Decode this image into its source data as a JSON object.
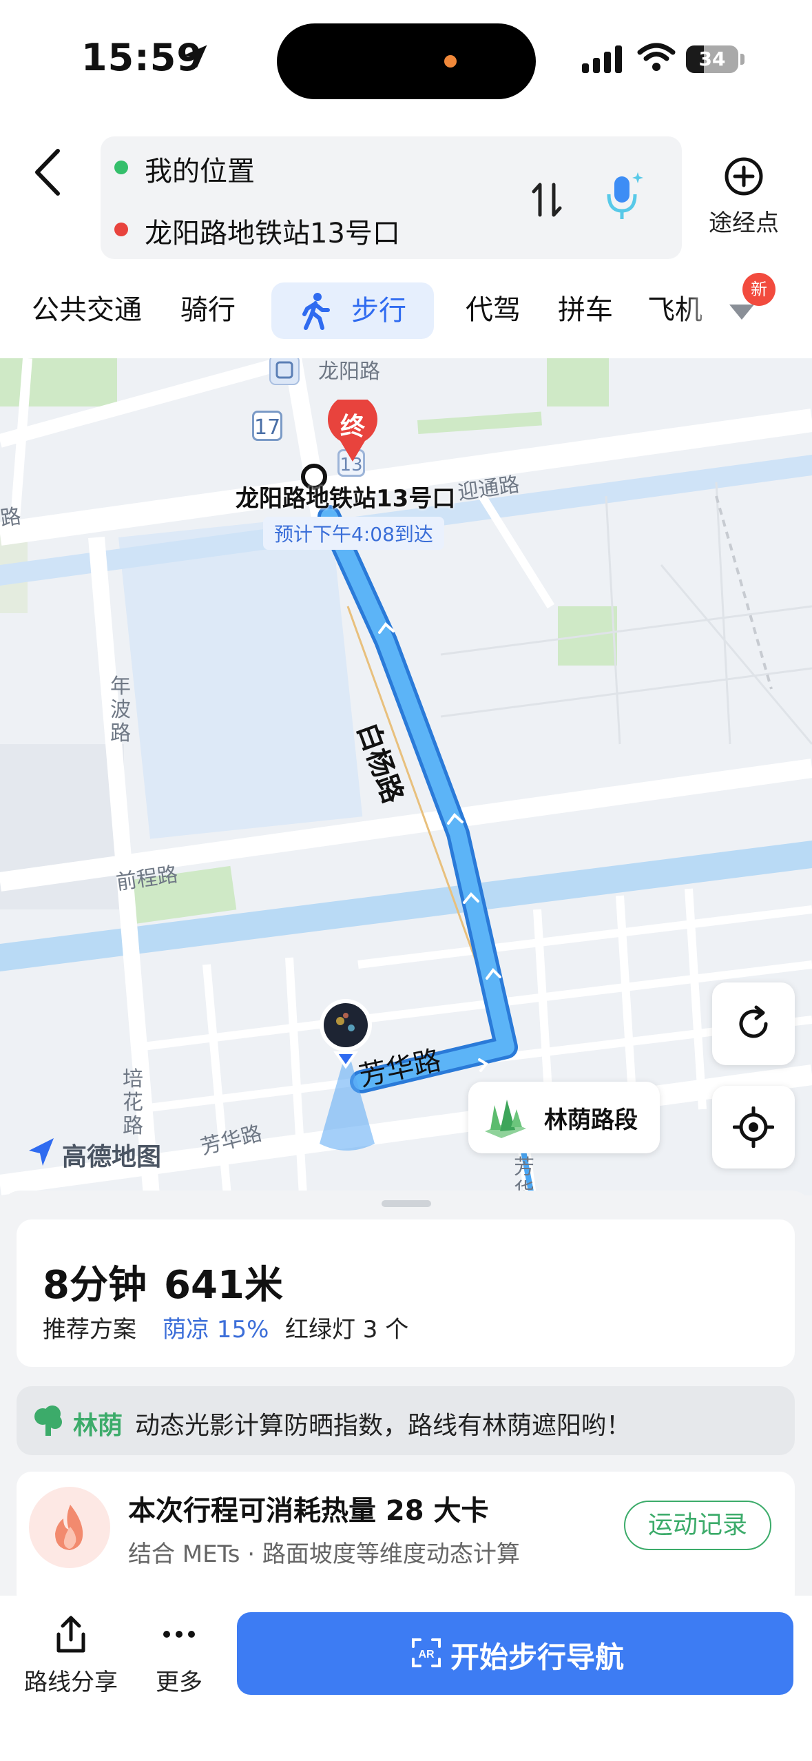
{
  "status_bar": {
    "time": "15:59",
    "battery": "34",
    "battery_level": 0.34
  },
  "header": {
    "origin": "我的位置",
    "destination": "龙阳路地铁站13号口",
    "waypoint_label": "途经点",
    "icons": [
      "back-icon",
      "swap-icon",
      "voice-icon",
      "add-waypoint-icon"
    ]
  },
  "tabs": {
    "items": [
      {
        "label": "公共交通"
      },
      {
        "label": "骑行"
      },
      {
        "label": "步行"
      },
      {
        "label": "代驾"
      },
      {
        "label": "拼车"
      },
      {
        "label": "飞机"
      }
    ],
    "active_index": 2,
    "new_badge": "新"
  },
  "map": {
    "street_labels": [
      "龙阳路",
      "年波路",
      "前程路",
      "培花路",
      "芳华路",
      "白杨路",
      "芳华路"
    ],
    "station_badges": [
      "17",
      "13"
    ],
    "partial_labels": [
      "路",
      "迎通路"
    ],
    "dest_pin_text": "终",
    "dest_name": "龙阳路地铁站13号口",
    "eta": "预计下午4:08到达",
    "shade_badge": "林荫路段",
    "logo": "高德地图",
    "route_color": "#4aa7f5"
  },
  "summary": {
    "time": "8分钟",
    "distance": "641米",
    "recommend": "推荐方案",
    "shade": "荫凉 15%",
    "lights": "红绿灯 3 个"
  },
  "tip": {
    "tag": "林荫",
    "text": "动态光影计算防晒指数，路线有林荫遮阳哟！"
  },
  "calorie": {
    "title": "本次行程可消耗热量 28 大卡",
    "subtitle": "结合 METs · 路面坡度等维度动态计算",
    "button": "运动记录"
  },
  "bottom": {
    "share": "路线分享",
    "more": "更多",
    "start": "开始步行导航"
  }
}
